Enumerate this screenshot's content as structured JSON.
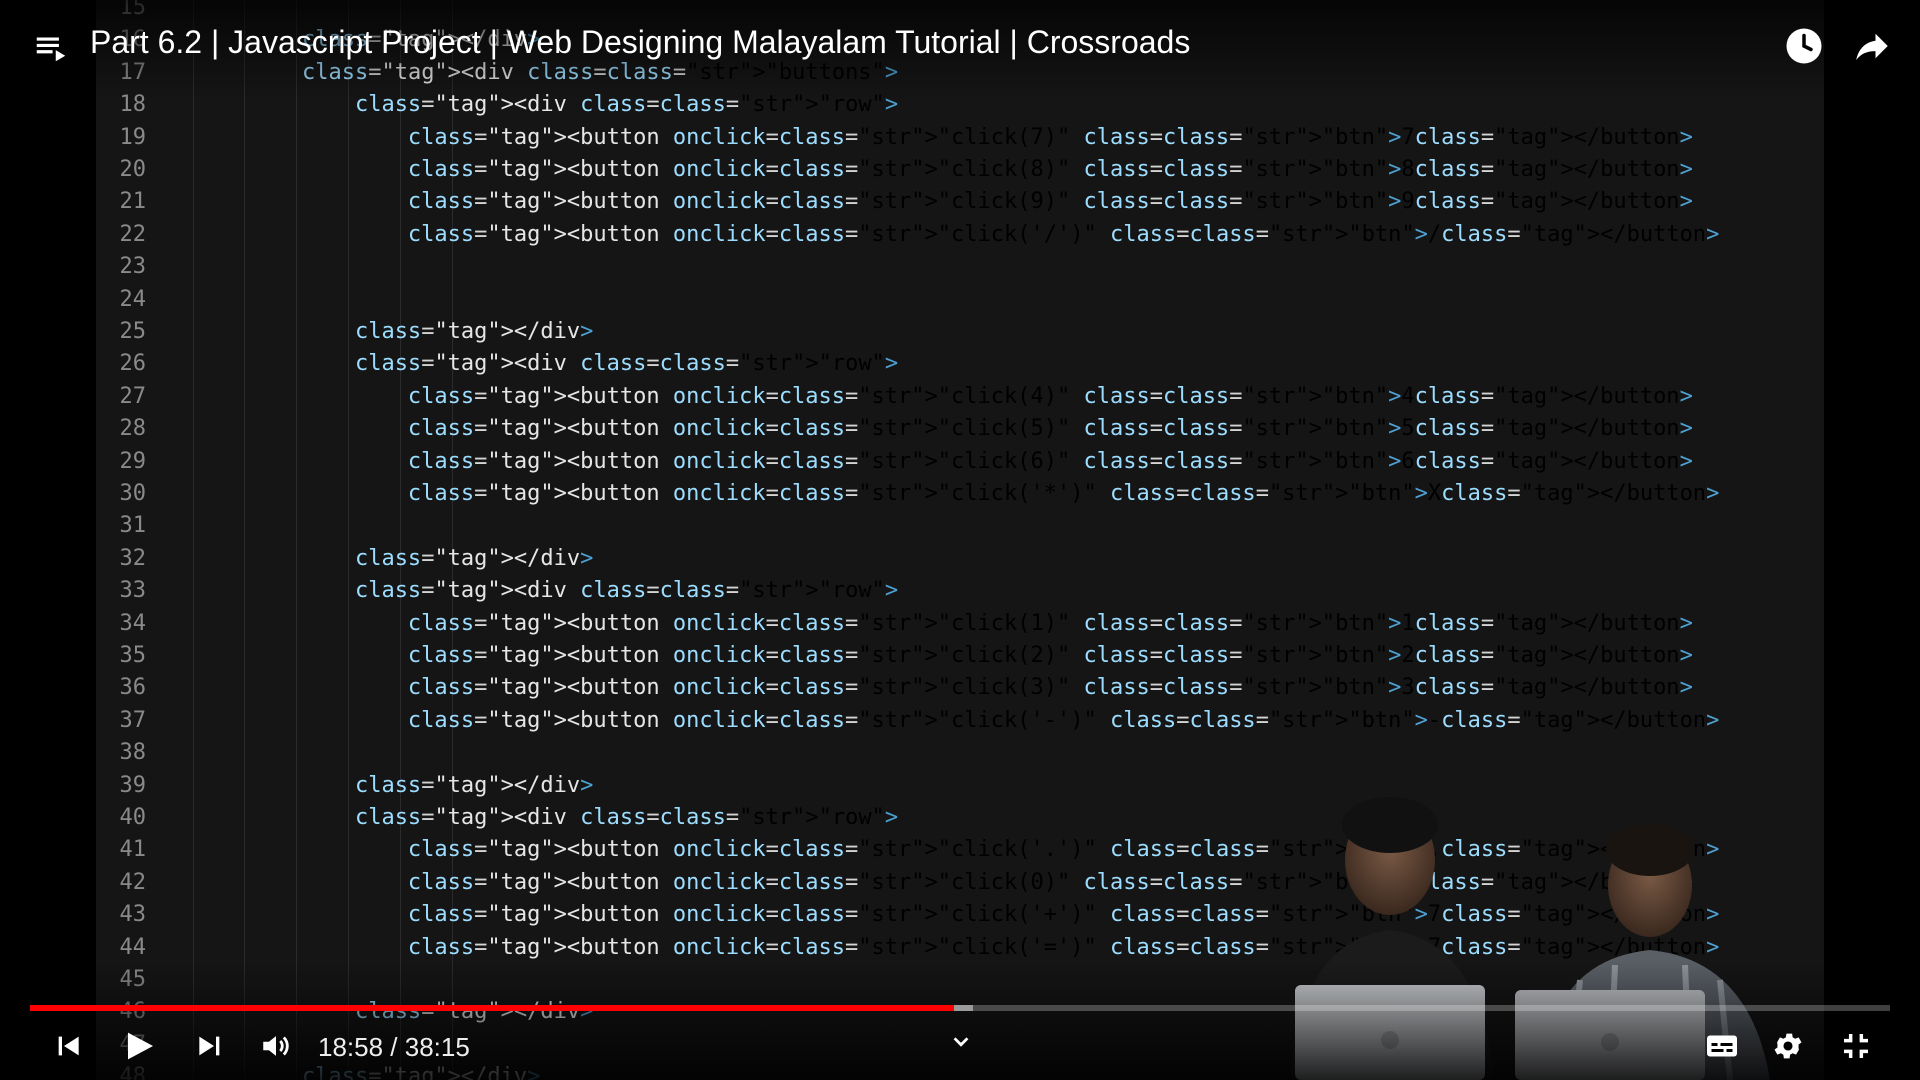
{
  "player": {
    "title": "Part 6.2 | Javascript Project | Web Designing Malayalam Tutorial | Crossroads",
    "time_display": "18:58 / 38:15",
    "progress_fraction": 0.4967,
    "buffer_fraction": 0.507,
    "accent_color": "#ff0000"
  },
  "icons": {
    "playlist": "playlist-icon",
    "watch_later": "clock-icon",
    "share": "share-icon",
    "prev": "skip-previous-icon",
    "play": "play-icon",
    "next": "skip-next-icon",
    "volume": "volume-icon",
    "chevron": "chevron-down-icon",
    "subtitles": "subtitles-icon",
    "settings": "gear-icon",
    "exit_fullscreen": "exit-fullscreen-icon"
  },
  "editor": {
    "line_numbers": [
      "15",
      "16",
      "17",
      "18",
      "19",
      "20",
      "21",
      "22",
      "23",
      "24",
      "25",
      "26",
      "27",
      "28",
      "29",
      "30",
      "31",
      "32",
      "33",
      "34",
      "35",
      "36",
      "37",
      "38",
      "39",
      "40",
      "41",
      "42",
      "43",
      "44",
      "45",
      "46",
      "47",
      "48"
    ],
    "lines": [
      "",
      "        </div>",
      "        <div class=\"buttons\">",
      "            <div class=\"row\">",
      "                <button onclick=\"click(7)\" class=\"btn\">7</button>",
      "                <button onclick=\"click(8)\" class=\"btn\">8</button>",
      "                <button onclick=\"click(9)\" class=\"btn\">9</button>",
      "                <button onclick=\"click('/')\" class=\"btn\">/</button>",
      "",
      "",
      "            </div>",
      "            <div class=\"row\">",
      "                <button onclick=\"click(4)\" class=\"btn\">4</button>",
      "                <button onclick=\"click(5)\" class=\"btn\">5</button>",
      "                <button onclick=\"click(6)\" class=\"btn\">6</button>",
      "                <button onclick=\"click('*')\" class=\"btn\">X</button>",
      "",
      "            </div>",
      "            <div class=\"row\">",
      "                <button onclick=\"click(1)\" class=\"btn\">1</button>",
      "                <button onclick=\"click(2)\" class=\"btn\">2</button>",
      "                <button onclick=\"click(3)\" class=\"btn\">3</button>",
      "                <button onclick=\"click('-')\" class=\"btn\">-</button>",
      "",
      "            </div>",
      "            <div class=\"row\">",
      "                <button onclick=\"click('.')\" class=\"btn\">.</button>",
      "                <button onclick=\"click(0)\" class=\"btn\">[</button>",
      "                <button onclick=\"click('+')\" class=\"btn\">7</button>",
      "                <button onclick=\"click('=')\" class=\"btn\">7</button>",
      "",
      "            </div>",
      "",
      "        </div>"
    ]
  }
}
